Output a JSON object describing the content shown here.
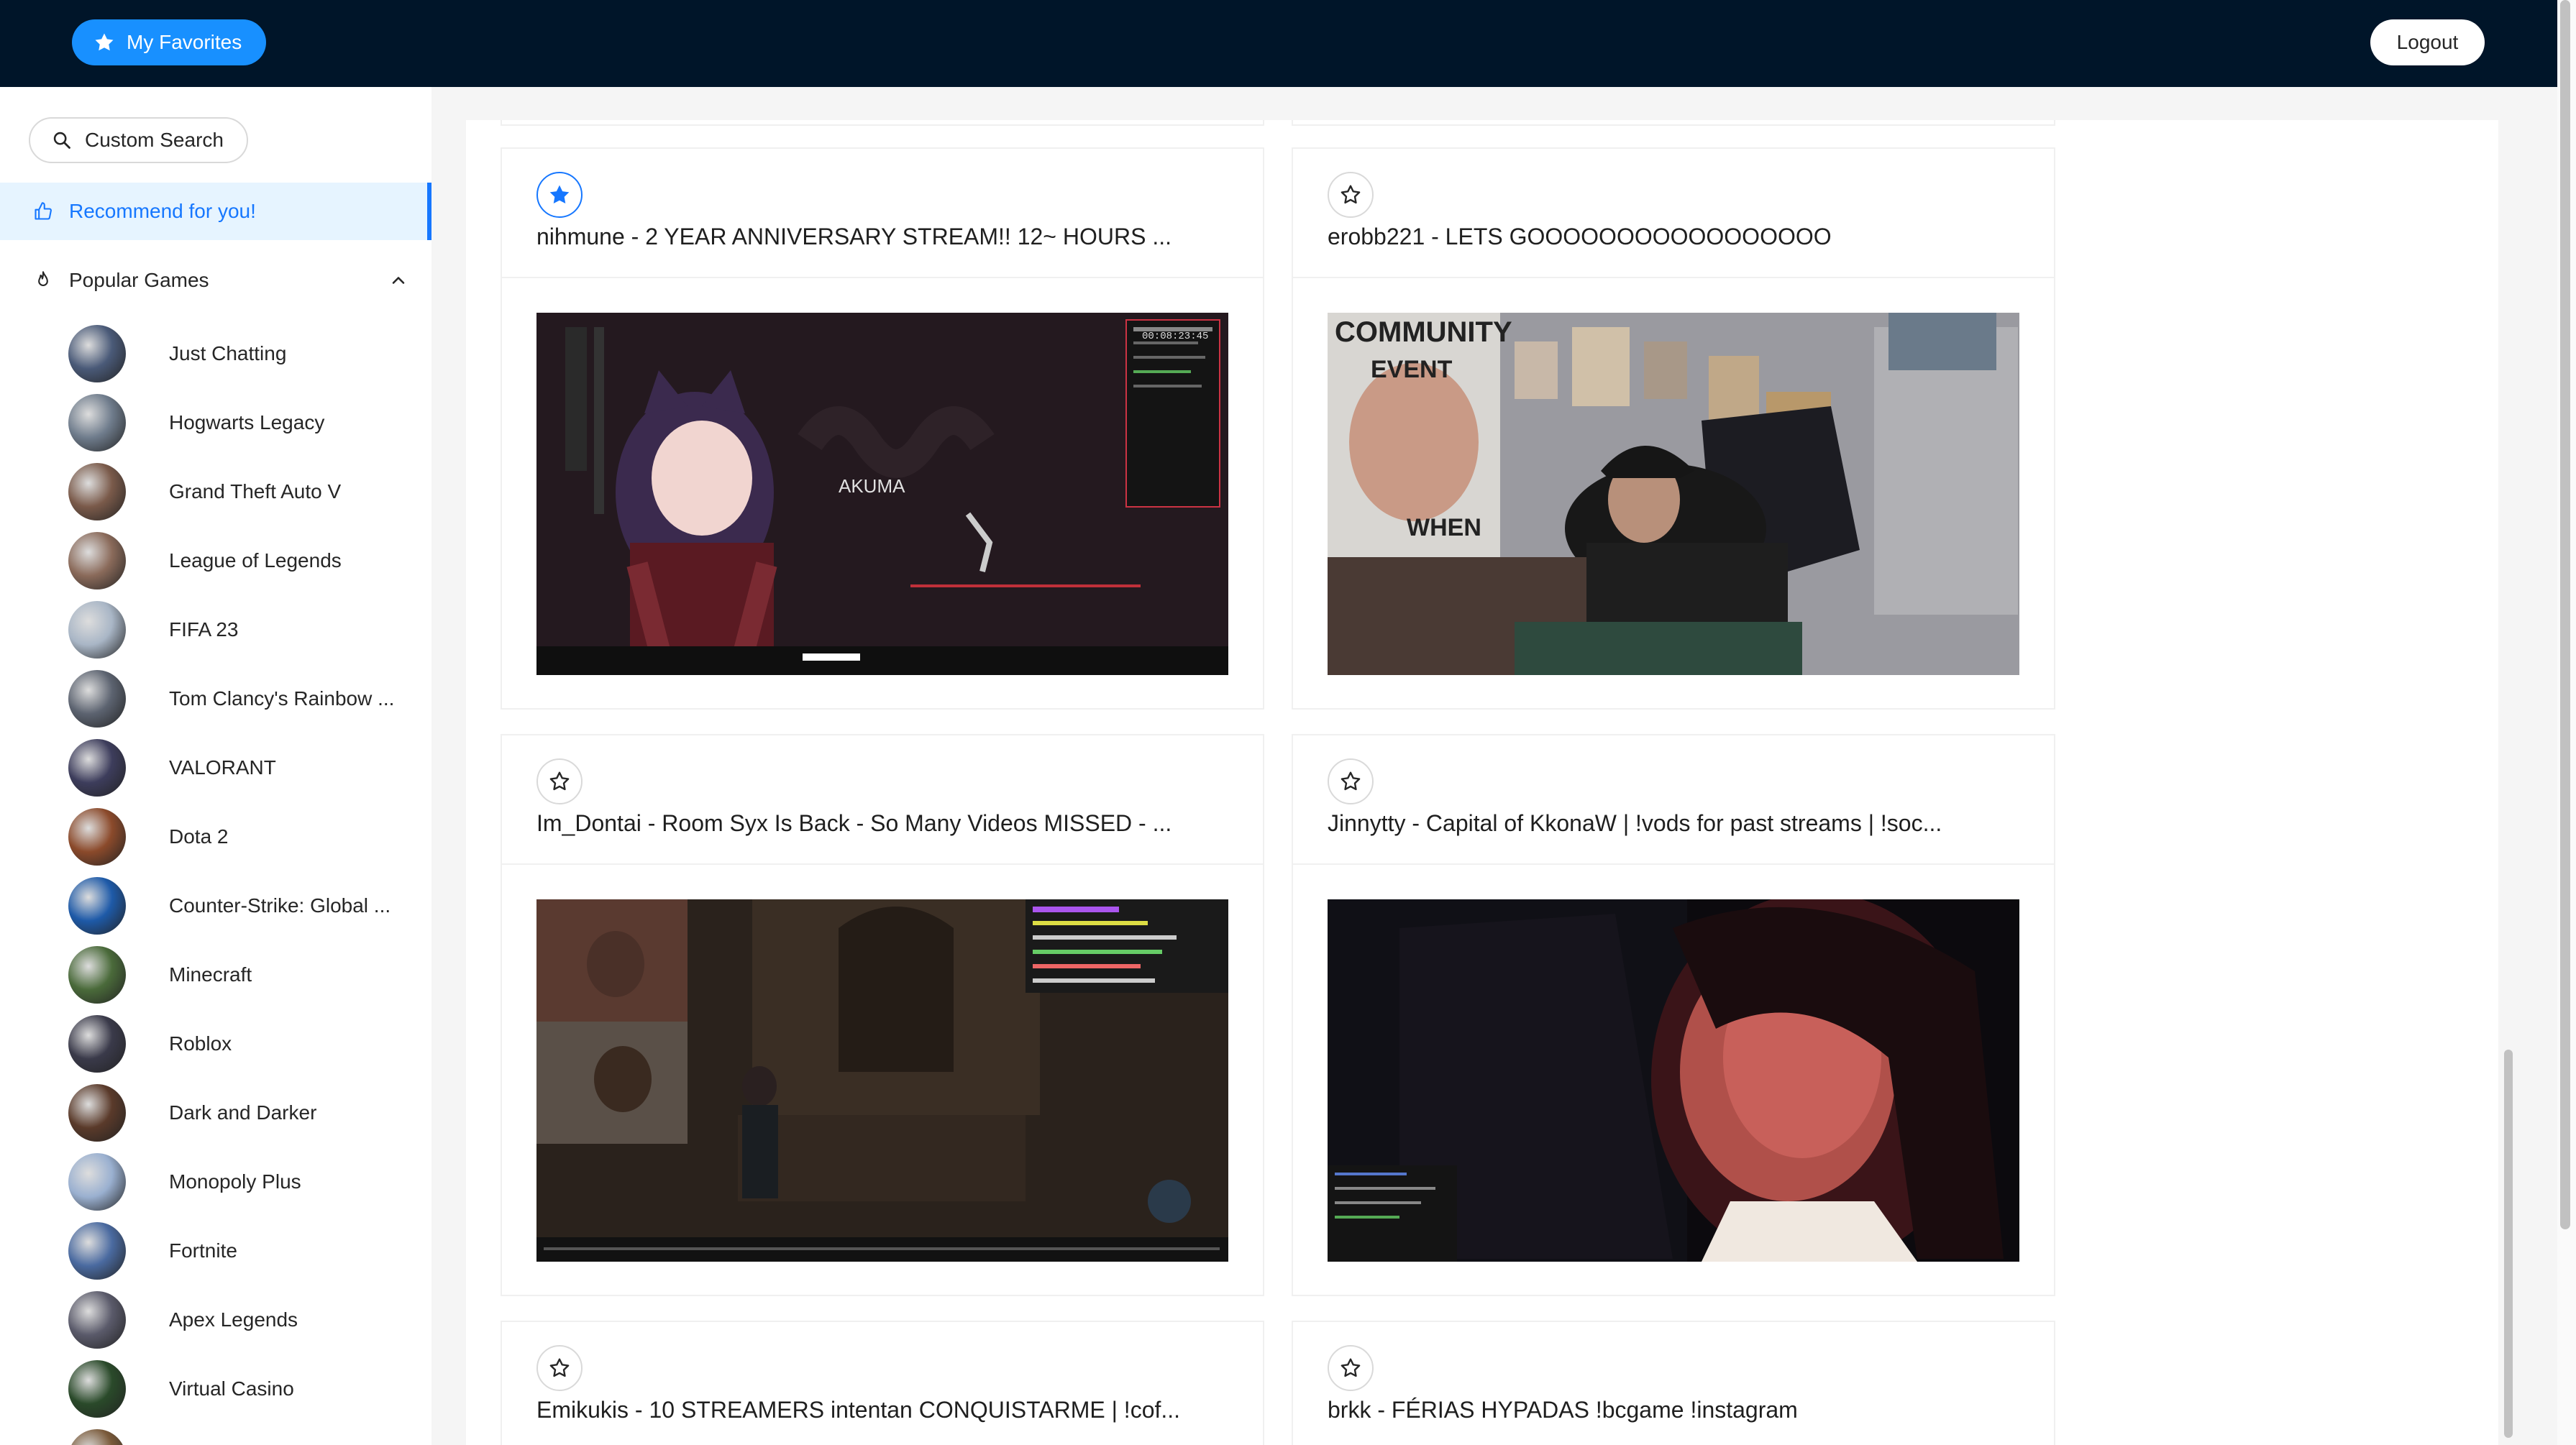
{
  "header": {
    "favorites_label": "My Favorites",
    "logout_label": "Logout"
  },
  "sidebar": {
    "search_label": "Custom Search",
    "recommend_label": "Recommend for you!",
    "popular_label": "Popular Games",
    "games": [
      {
        "name": "Just Chatting",
        "color": "#4a5a78"
      },
      {
        "name": "Hogwarts Legacy",
        "color": "#6f7c8c"
      },
      {
        "name": "Grand Theft Auto V",
        "color": "#7a5a4a"
      },
      {
        "name": "League of Legends",
        "color": "#8a6a5a"
      },
      {
        "name": "FIFA 23",
        "color": "#a9b6c6"
      },
      {
        "name": "Tom Clancy's Rainbow ...",
        "color": "#5c6370"
      },
      {
        "name": "VALORANT",
        "color": "#3d3d5c"
      },
      {
        "name": "Dota 2",
        "color": "#8b4a2b"
      },
      {
        "name": "Counter-Strike: Global ...",
        "color": "#1e5aa8"
      },
      {
        "name": "Minecraft",
        "color": "#4a6a3a"
      },
      {
        "name": "Roblox",
        "color": "#3a3a4a"
      },
      {
        "name": "Dark and Darker",
        "color": "#5a3a2a"
      },
      {
        "name": "Monopoly Plus",
        "color": "#9ab0d0"
      },
      {
        "name": "Fortnite",
        "color": "#4a6aa0"
      },
      {
        "name": "Apex Legends",
        "color": "#5a5a6a"
      },
      {
        "name": "Virtual Casino",
        "color": "#2a4a2a"
      },
      {
        "name": "",
        "color": "#7a5a3a"
      }
    ]
  },
  "streams": [
    {
      "title": "nihmune - 2 YEAR ANNIVERSARY STREAM!! 12~ HOURS ...",
      "favorited": true
    },
    {
      "title": "erobb221 - LETS GOOOOOOOOOOOOOOOOO",
      "favorited": false
    },
    {
      "title": "Im_Dontai - Room Syx Is Back - So Many Videos MISSED - ...",
      "favorited": false
    },
    {
      "title": "Jinnytty - Capital of KkonaW | !vods for past streams | !soc...",
      "favorited": false
    },
    {
      "title": "Emikukis - 10 STREAMERS intentan CONQUISTARME | !cof...",
      "favorited": false
    },
    {
      "title": "brkk - FÉRIAS HYPADAS !bcgame !instagram",
      "favorited": false
    }
  ],
  "thumbnail_text": {
    "akuma": "AKUMA",
    "community": "COMMUNITY",
    "event": "EVENT",
    "when": "WHEN",
    "timer": "00:08:23:45"
  },
  "colors": {
    "header_bg": "#001529",
    "primary": "#1890ff",
    "selected_bg": "#e6f4ff"
  }
}
